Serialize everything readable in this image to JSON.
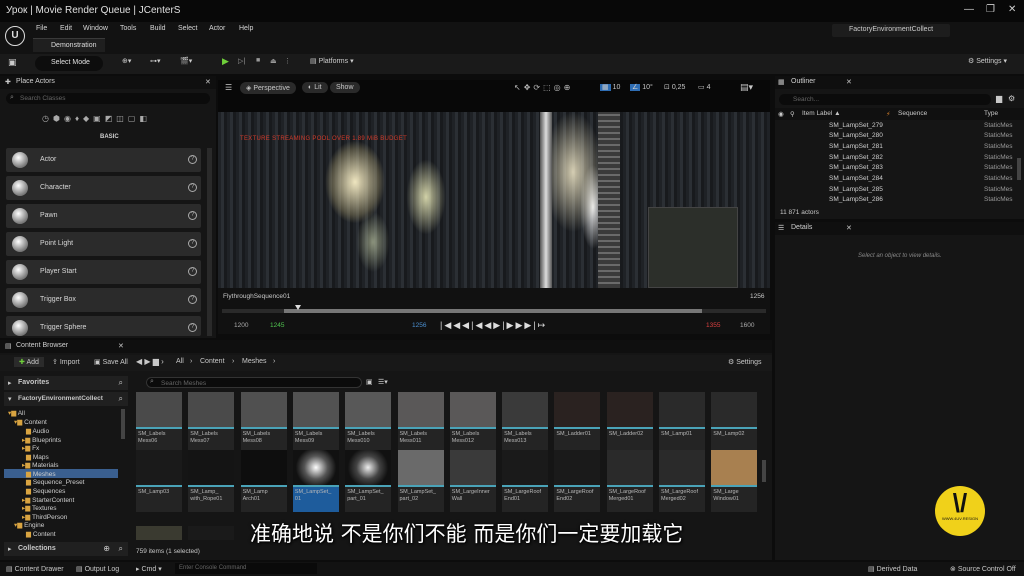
{
  "window": {
    "title": "Урок  | Movie Render Queue | JCenterS",
    "project": "FactoryEnvironmentCollect"
  },
  "menu": [
    "File",
    "Edit",
    "Window",
    "Tools",
    "Build",
    "Select",
    "Actor",
    "Help"
  ],
  "doc_tab": "Demonstration",
  "toolbar": {
    "select_mode": "Select Mode",
    "platforms": "Platforms",
    "settings": "Settings"
  },
  "place_actors": {
    "title": "Place Actors",
    "search_placeholder": "Search Classes",
    "category": "BASIC",
    "items": [
      "Actor",
      "Character",
      "Pawn",
      "Point Light",
      "Player Start",
      "Trigger Box",
      "Trigger Sphere"
    ]
  },
  "viewport": {
    "perspective": "Perspective",
    "lit": "Lit",
    "show": "Show",
    "grid": "10",
    "angle": "10°",
    "scale": "0,25",
    "cam": "4",
    "warning": "TEXTURE STREAMING POOL OVER 1.89 MiB BUDGET"
  },
  "sequencer": {
    "name": "FlythroughSequence01",
    "end": "1256",
    "start": "1200",
    "mark_green": "1245",
    "current": "1256",
    "mark_red": "1355",
    "max": "1600"
  },
  "outliner": {
    "title": "Outliner",
    "search_placeholder": "Search...",
    "col_label": "Item Label ▲",
    "col_seq": "Sequence",
    "col_type": "Type",
    "rows": [
      "SM_LampSet_279",
      "SM_LampSet_280",
      "SM_LampSet_281",
      "SM_LampSet_282",
      "SM_LampSet_283",
      "SM_LampSet_284",
      "SM_LampSet_285",
      "SM_LampSet_286"
    ],
    "type": "StaticMes",
    "count": "11 871 actors"
  },
  "details": {
    "title": "Details",
    "empty": "Select an object to view details."
  },
  "content_browser": {
    "title": "Content Browser",
    "add": "Add",
    "import": "Import",
    "save_all": "Save All",
    "path": [
      "All",
      "Content",
      "Meshes"
    ],
    "settings": "Settings",
    "favorites": "Favorites",
    "project": "FactoryEnvironmentCollect",
    "search_placeholder": "Search Meshes",
    "collections": "Collections",
    "count": "759 items (1 selected)",
    "tree": [
      "All",
      "Content",
      "Audio",
      "Blueprints",
      "Fx",
      "Materials",
      "Maps",
      "Meshes",
      "Sequence_Preset",
      "Sequences",
      "StarterContent",
      "Textures",
      "ThirdPerson",
      "Engine",
      "Content"
    ],
    "row1": [
      "SM_Labels\nMess06",
      "SM_Labels\nMess07",
      "SM_Labels\nMess08",
      "SM_Labels\nMess09",
      "SM_Labels\nMess010",
      "SM_Labels\nMess011",
      "SM_Labels\nMess012",
      "SM_Labels\nMess013",
      "SM_Ladder01",
      "SM_Ladder02",
      "SM_Lamp01",
      "SM_Lamp02"
    ],
    "row2": [
      "SM_Lamp03",
      "SM_Lamp_\nwith_Rope01",
      "SM_Lamp\nArch01",
      "SM_LampSet_\n01",
      "SM_LampSet_\npart_01",
      "SM_LampSet_\npart_02",
      "SM_LargeInner\nWall",
      "SM_LargeRoof\nEnd01",
      "SM_LargeRoof\nEnd02",
      "SM_LargeRoof\nMerged01",
      "SM_LargeRoof\nMerged02",
      "SM_Large\nWindow01"
    ]
  },
  "bottom": {
    "content_drawer": "Content Drawer",
    "output_log": "Output Log",
    "cmd": "Cmd",
    "console_placeholder": "Enter Console Command",
    "derived": "Derived Data",
    "source": "Source Control Off"
  },
  "subtitle": "准确地说 不是你们不能 而是你们一定要加载它",
  "watermark": "WWW.4UV.RESIGN"
}
